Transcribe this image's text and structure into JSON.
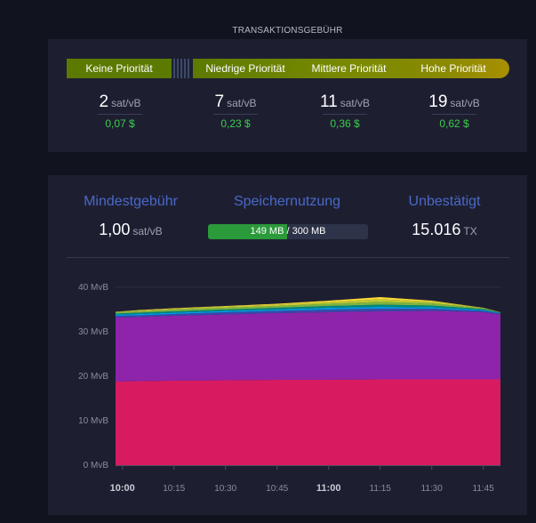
{
  "fees": {
    "title": "TRANSAKTIONSGEBÜHR",
    "priorities": [
      "Keine Priorität",
      "Niedrige Priorität",
      "Mittlere Priorität",
      "Hohe Priorität"
    ],
    "values": [
      {
        "fee": "2",
        "unit": "sat/vB",
        "usd": "0,07 $"
      },
      {
        "fee": "7",
        "unit": "sat/vB",
        "usd": "0,23 $"
      },
      {
        "fee": "11",
        "unit": "sat/vB",
        "usd": "0,36 $"
      },
      {
        "fee": "19",
        "unit": "sat/vB",
        "usd": "0,62 $"
      }
    ]
  },
  "mempool": {
    "min_fee_label": "Mindestgebühr",
    "min_fee_value": "1,00",
    "min_fee_unit": "sat/vB",
    "usage_label": "Speichernutzung",
    "usage_used": "149 MB",
    "usage_total": " / 300 MB",
    "usage_fraction": 0.497,
    "unconfirmed_label": "Unbestätigt",
    "unconfirmed_value": "15.016",
    "unconfirmed_unit": "TX"
  },
  "chart_data": {
    "type": "area",
    "y_unit": "MvB",
    "ylim": [
      0,
      40
    ],
    "y_ticks": [
      "0 MvB",
      "10 MvB",
      "20 MvB",
      "30 MvB",
      "40 MvB"
    ],
    "x_ticks": [
      "10:00",
      "10:15",
      "10:30",
      "10:45",
      "11:00",
      "11:15",
      "11:30",
      "11:45"
    ],
    "bold_x_ticks": [
      "10:00",
      "11:00"
    ],
    "x": [
      "09:58",
      "10:05",
      "10:15",
      "10:30",
      "10:45",
      "11:00",
      "11:15",
      "11:30",
      "11:45",
      "11:50"
    ],
    "series": [
      {
        "color": "#d81b60",
        "values": [
          18.8,
          18.9,
          19.0,
          19.1,
          19.2,
          19.2,
          19.3,
          19.3,
          19.3,
          19.3
        ]
      },
      {
        "color": "#8e24aa",
        "values": [
          14.4,
          14.4,
          14.6,
          14.8,
          15.0,
          15.2,
          15.3,
          15.4,
          15.1,
          14.6
        ]
      },
      {
        "color": "#3949ab",
        "values": [
          0.4,
          0.4,
          0.4,
          0.5,
          0.5,
          0.6,
          0.6,
          0.5,
          0.3,
          0.2
        ]
      },
      {
        "color": "#039be5",
        "values": [
          0.3,
          0.3,
          0.3,
          0.3,
          0.3,
          0.4,
          0.4,
          0.3,
          0.2,
          0.1
        ]
      },
      {
        "color": "#00897b",
        "values": [
          0.2,
          0.3,
          0.3,
          0.3,
          0.4,
          0.4,
          0.5,
          0.4,
          0.2,
          0.1
        ]
      },
      {
        "color": "#7cb342",
        "values": [
          0.3,
          0.3,
          0.4,
          0.4,
          0.4,
          0.5,
          0.6,
          0.5,
          0.2,
          0.1
        ]
      },
      {
        "color": "#c0ca33",
        "values": [
          0.1,
          0.2,
          0.2,
          0.3,
          0.3,
          0.4,
          0.6,
          0.4,
          0.1,
          0.0
        ]
      },
      {
        "color": "#fdd835",
        "values": [
          0.0,
          0.1,
          0.1,
          0.1,
          0.2,
          0.3,
          0.5,
          0.2,
          0.0,
          0.0
        ]
      }
    ]
  }
}
